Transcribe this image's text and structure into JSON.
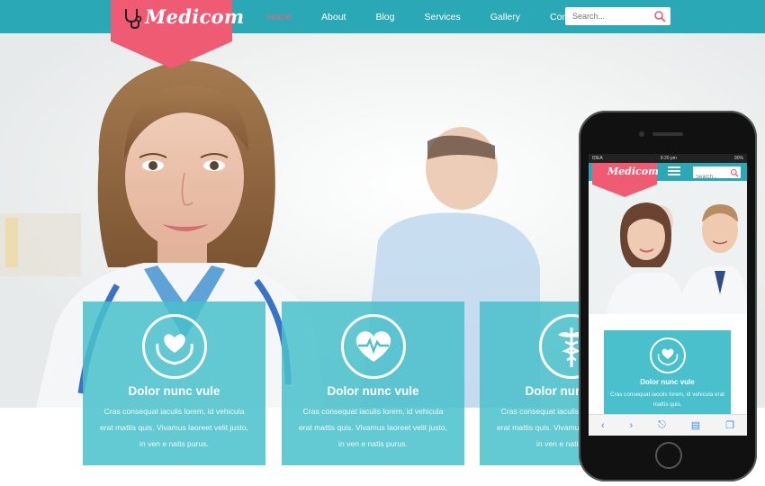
{
  "brand": {
    "name": "Medicom"
  },
  "nav": {
    "items": [
      {
        "label": "Home",
        "active": true
      },
      {
        "label": "About",
        "active": false
      },
      {
        "label": "Blog",
        "active": false
      },
      {
        "label": "Services",
        "active": false
      },
      {
        "label": "Gallery",
        "active": false
      },
      {
        "label": "Contact",
        "active": false
      }
    ]
  },
  "search": {
    "placeholder": "Search..."
  },
  "features": [
    {
      "icon": "hands-heart-icon",
      "title": "Dolor nunc vule",
      "text": "Cras consequat iaculis lorem, id vehicula erat mattis quis. Vivamus laoreet velit justo, in ven e natis purus."
    },
    {
      "icon": "heart-pulse-icon",
      "title": "Dolor nunc vule",
      "text": "Cras consequat iaculis lorem, id vehicula erat mattis quis. Vivamus laoreet velit justo, in ven e natis purus."
    },
    {
      "icon": "caduceus-icon",
      "title": "Dolor nunc vule",
      "text": "Cras consequat iaculis lorem, id vehicula erat mattis quis. Vivamus laoreet velit justo, in ven e natis purus."
    }
  ],
  "phone": {
    "status_carrier": "IDEA",
    "status_time": "9:20 pm",
    "status_battery": "90%",
    "brand": "Medicom",
    "search_placeholder": "Search...",
    "feature_title": "Dolor nunc vule",
    "feature_text": "Cras consequat iaculis lorem, id vehicula erat mattis quis."
  },
  "colors": {
    "accent": "#2ba8b6",
    "feature_bg": "#49c0cb",
    "ribbon": "#ef5b73",
    "active_nav": "#f0607a"
  }
}
